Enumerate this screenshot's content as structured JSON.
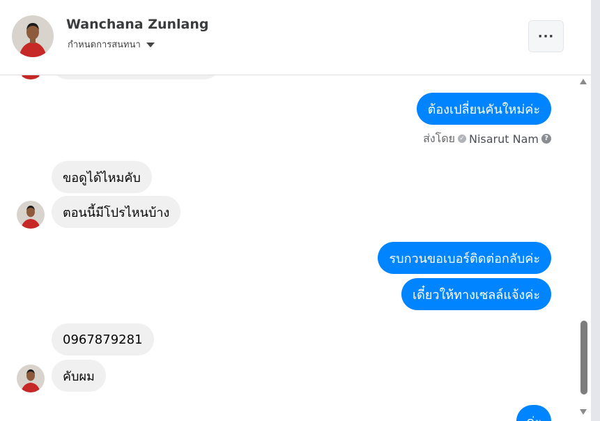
{
  "header": {
    "contact_name": "Wanchana Zunlang",
    "subtitle": "กำหนดการสนทนา",
    "more_label": "···"
  },
  "messages": {
    "out1": "ต้องเปลี่ยนคันใหม่ค่ะ",
    "sent_by_prefix": "ส่งโดย",
    "sent_by_agent": "Nisarut Nam",
    "in1": "ขอดูได้ไหมคับ",
    "in2": "ตอนนี้มีโปรไหนบ้าง",
    "out2": "รบกวนขอเบอร์ติดต่อกลับค่ะ",
    "out3": "เดี๋ยวให้ทางเซลล์แจ้งค่ะ",
    "in3": "0967879281",
    "in4": "คับผม",
    "out4": "ค่ะ"
  },
  "colors": {
    "outgoing_bubble": "#0084ff",
    "incoming_bubble": "#f0f0f0"
  },
  "icons": {
    "sent_check": "check-circle-icon",
    "help": "question-circle-icon"
  }
}
